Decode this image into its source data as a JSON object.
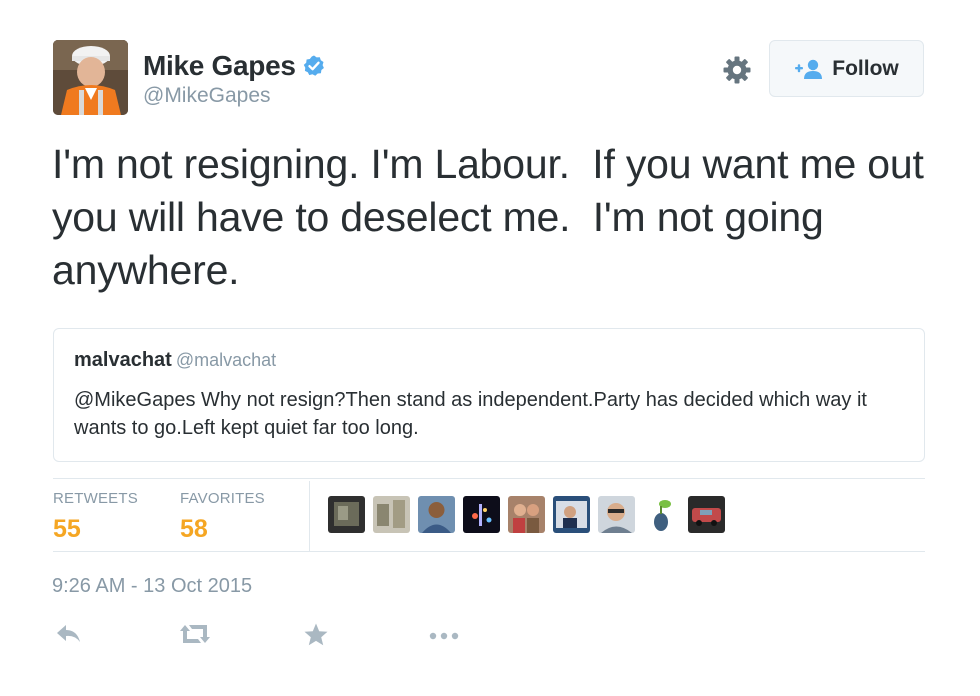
{
  "author": {
    "display_name": "Mike Gapes",
    "screen_name": "@MikeGapes",
    "verified": true,
    "avatar_icon": "avatar-photo"
  },
  "header": {
    "follow_label": "Follow",
    "gear_icon": "gear-icon",
    "follow_icon": "add-user-icon"
  },
  "tweet": {
    "text": "I'm not resigning. I'm Labour.  If you want me out you will have to deselect me.  I'm not going anywhere."
  },
  "quoted_tweet": {
    "name": "malvachat",
    "handle": "@malvachat",
    "text": "@MikeGapes Why not resign?Then stand as independent.Party has decided which way it wants to go.Left kept quiet far too long."
  },
  "stats": {
    "retweets_label": "RETWEETS",
    "retweets_count": "55",
    "favorites_label": "FAVORITES",
    "favorites_count": "58"
  },
  "favoriters": [
    "face-1",
    "face-2",
    "face-3",
    "face-4",
    "face-5",
    "face-6",
    "face-7",
    "face-8",
    "face-9"
  ],
  "timestamp": "9:26 AM - 13 Oct 2015",
  "actions": [
    "reply-icon",
    "retweet-icon",
    "favorite-icon",
    "more-icon"
  ],
  "colors": {
    "accent_count": "#f5a623",
    "muted": "#8899a6",
    "verified_blue": "#55acee",
    "border": "#e1e8ed"
  }
}
